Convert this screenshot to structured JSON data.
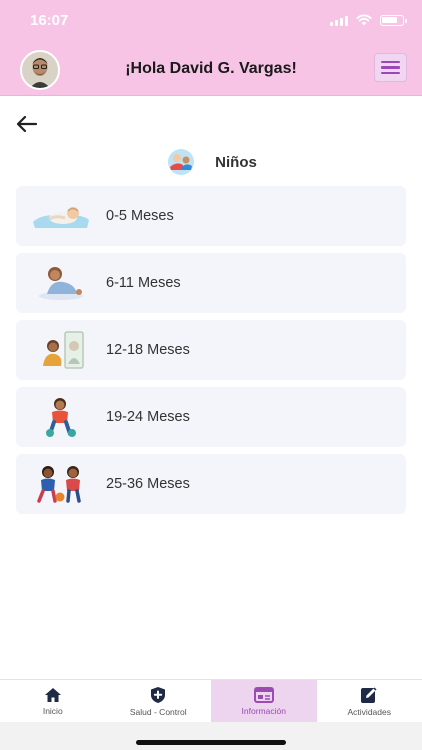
{
  "status_bar": {
    "time": "16:07"
  },
  "header": {
    "greeting": "¡Hola David G. Vargas!"
  },
  "section": {
    "title": "Niños"
  },
  "age_groups": [
    {
      "label": "0-5 Meses"
    },
    {
      "label": "6-11 Meses"
    },
    {
      "label": "12-18 Meses"
    },
    {
      "label": "19-24 Meses"
    },
    {
      "label": "25-36 Meses"
    }
  ],
  "bottom_nav": {
    "active_tab": "Información",
    "tabs": [
      {
        "label": "Inicio",
        "icon": "home-icon"
      },
      {
        "label": "Salud - Control",
        "icon": "health-shield-icon"
      },
      {
        "label": "Información",
        "icon": "info-panel-icon"
      },
      {
        "label": "Actividades",
        "icon": "edit-icon"
      }
    ]
  },
  "colors": {
    "header_bg": "#f7c4e6",
    "accent": "#9c4bb3",
    "card_bg": "#f3f5fa",
    "active_tab_bg": "#edd5f0"
  }
}
